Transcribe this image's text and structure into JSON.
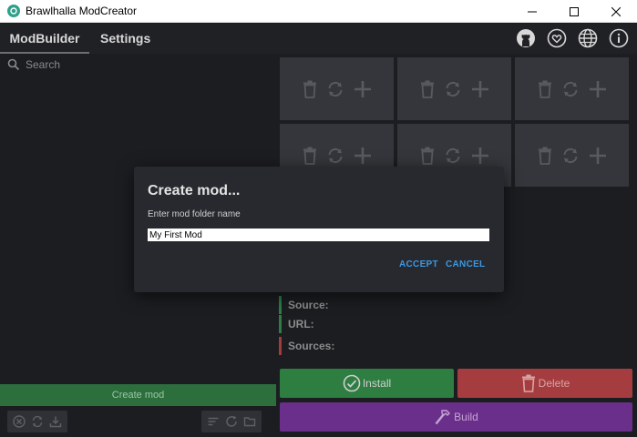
{
  "window": {
    "title": "Brawlhalla ModCreator"
  },
  "header": {
    "tabs": [
      {
        "label": "ModBuilder"
      },
      {
        "label": "Settings"
      }
    ],
    "icons": [
      "github-icon",
      "heart-icon",
      "globe-icon",
      "info-icon"
    ]
  },
  "sidebar": {
    "search_placeholder": "Search",
    "create_mod_label": "Create mod",
    "left_tools": [
      "close-icon",
      "sync-icon",
      "download-icon"
    ],
    "right_tools": [
      "sort-icon",
      "refresh-icon",
      "folder-icon"
    ]
  },
  "slots": {
    "count": 6,
    "actions": [
      "trash-icon",
      "swap-icon",
      "plus-icon"
    ]
  },
  "info": {
    "source_label": "Source:",
    "url_label": "URL:",
    "sources_label": "Sources:"
  },
  "actions": {
    "install_label": "Install",
    "delete_label": "Delete",
    "build_label": "Build"
  },
  "dialog": {
    "title": "Create mod...",
    "prompt": "Enter mod folder name",
    "input_value": "My First Mod",
    "accept_label": "ACCEPT",
    "cancel_label": "CANCEL"
  },
  "colors": {
    "green": "#2e7d41",
    "red": "#a53d40",
    "purple": "#6a2f8a",
    "accent_blue": "#3c98e0"
  }
}
